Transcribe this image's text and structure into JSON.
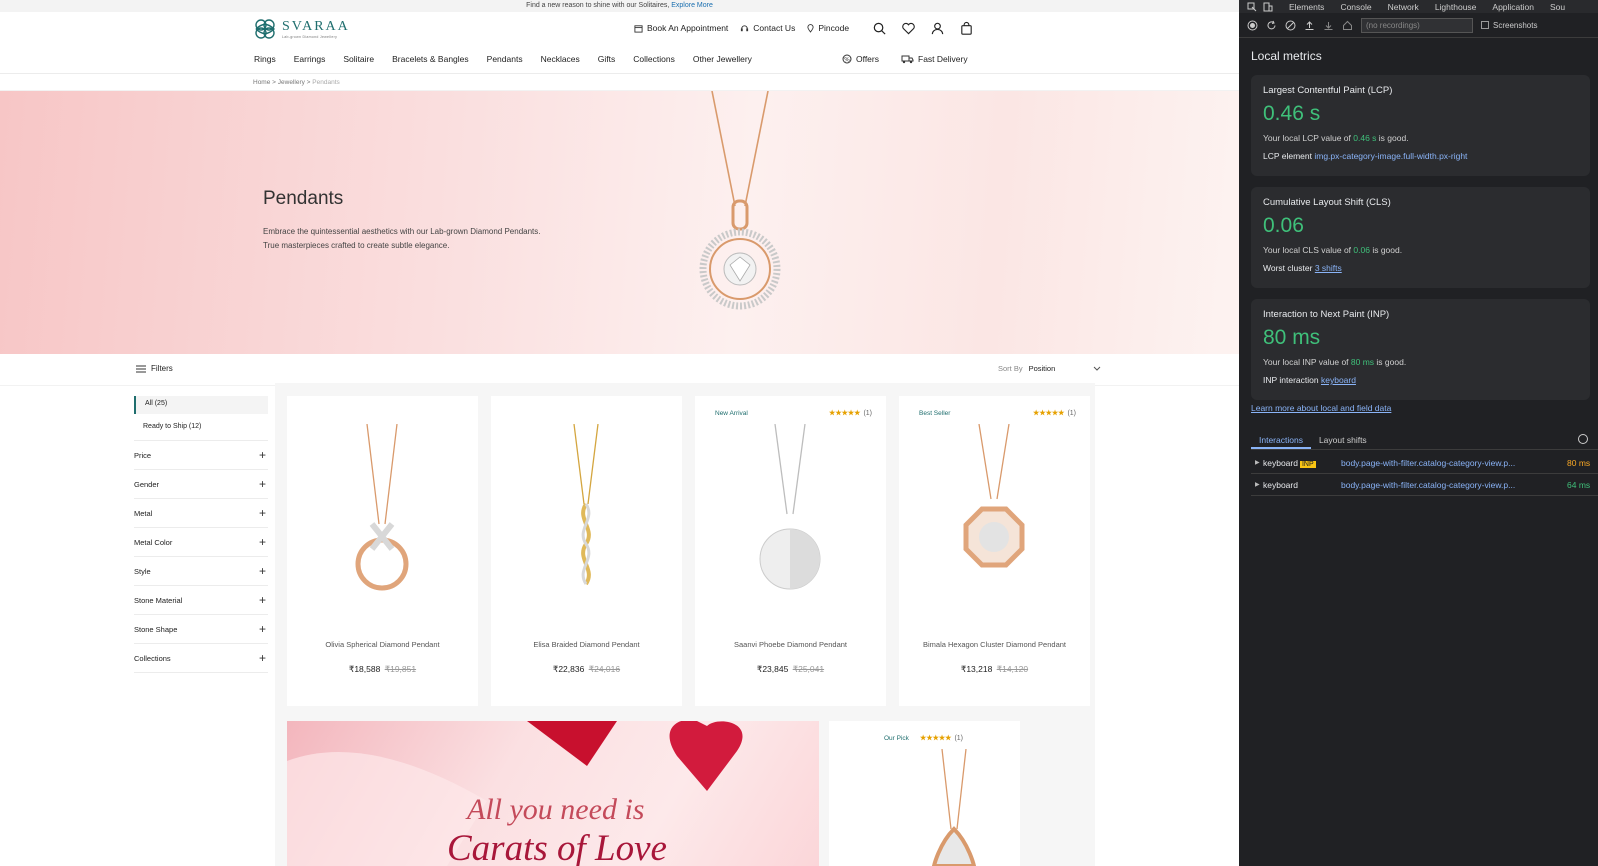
{
  "announcement": {
    "text": "Find a new reason to shine with our Solitaires,",
    "link": "Explore More"
  },
  "brand": {
    "name": "SVARAA",
    "tagline": "Lab-grown Diamond Jewellery",
    "color": "#1f6e6e"
  },
  "header": {
    "links": [
      {
        "icon": "calendar-icon",
        "label": "Book An Appointment"
      },
      {
        "icon": "headset-icon",
        "label": "Contact Us"
      },
      {
        "icon": "location-pin-icon",
        "label": "Pincode"
      }
    ],
    "icons": [
      "search-icon",
      "heart-icon",
      "user-icon",
      "bag-icon"
    ]
  },
  "nav": {
    "items": [
      "Rings",
      "Earrings",
      "Solitaire",
      "Bracelets & Bangles",
      "Pendants",
      "Necklaces",
      "Gifts",
      "Collections",
      "Other Jewellery"
    ],
    "offers": "Offers",
    "fast_delivery": "Fast Delivery"
  },
  "breadcrumb": {
    "home": "Home",
    "sep": ">",
    "level1": "Jewellery",
    "current": "Pendants"
  },
  "hero": {
    "title": "Pendants",
    "description": "Embrace the quintessential aesthetics with our Lab-grown Diamond Pendants. True masterpieces crafted to create subtle elegance."
  },
  "toolbar": {
    "filters_label": "Filters",
    "sort_label": "Sort By",
    "sort_value": "Position"
  },
  "sidebar": {
    "options": [
      "All (25)",
      "Ready to Ship (12)"
    ],
    "facets": [
      "Price",
      "Gender",
      "Metal",
      "Metal Color",
      "Style",
      "Stone Material",
      "Stone Shape",
      "Collections"
    ]
  },
  "products": [
    {
      "tag": "",
      "stars": "",
      "count": "",
      "name": "Olivia Spherical Diamond Pendant",
      "price": "₹18,588",
      "old_price": "₹19,851",
      "metal": "rose"
    },
    {
      "tag": "",
      "stars": "",
      "count": "",
      "name": "Elisa Braided Diamond Pendant",
      "price": "₹22,836",
      "old_price": "₹24,016",
      "metal": "yellow"
    },
    {
      "tag": "New Arrival",
      "stars": "★★★★★",
      "count": "(1)",
      "name": "Saanvi Phoebe Diamond Pendant",
      "price": "₹23,845",
      "old_price": "₹25,041",
      "metal": "white"
    },
    {
      "tag": "Best Seller",
      "stars": "★★★★★",
      "count": "(1)",
      "name": "Bimala Hexagon Cluster Diamond Pendant",
      "price": "₹13,218",
      "old_price": "₹14,120",
      "metal": "rose"
    }
  ],
  "banner": {
    "line1": "All you need is",
    "line2": "Carats of Love"
  },
  "product5": {
    "tag": "Our Pick",
    "stars": "★★★★★",
    "count": "(1)"
  },
  "devtools": {
    "tabs": [
      "Elements",
      "Console",
      "Network",
      "Lighthouse",
      "Application",
      "Sou"
    ],
    "recordings_placeholder": "(no recordings)",
    "screenshots_label": "Screenshots",
    "title": "Local metrics",
    "lcp": {
      "title": "Largest Contentful Paint (LCP)",
      "value": "0.46 s",
      "desc_pre": "Your local LCP value of ",
      "desc_val": "0.46 s",
      "desc_post": " is good.",
      "el_label": "LCP element",
      "el_value": "img.px-category-image.full-width.px-right"
    },
    "cls": {
      "title": "Cumulative Layout Shift (CLS)",
      "value": "0.06",
      "desc_pre": "Your local CLS value of ",
      "desc_val": "0.06",
      "desc_post": " is good.",
      "el_label": "Worst cluster",
      "el_value": "3 shifts"
    },
    "inp": {
      "title": "Interaction to Next Paint (INP)",
      "value": "80 ms",
      "desc_pre": "Your local INP value of ",
      "desc_val": "80 ms",
      "desc_post": " is good.",
      "el_label": "INP interaction",
      "el_value": "keyboard"
    },
    "learn_more": "Learn more about local and field data",
    "sub_tabs": [
      "Interactions",
      "Layout shifts"
    ],
    "interactions": [
      {
        "type": "keyboard",
        "badge": "INP",
        "selector": "body.page-with-filter.catalog-category-view.p...",
        "duration": "80 ms"
      },
      {
        "type": "keyboard",
        "badge": "",
        "selector": "body.page-with-filter.catalog-category-view.p...",
        "duration": "64 ms"
      }
    ],
    "good_color": "#3fc07a",
    "link_color": "#8ab4f8"
  }
}
